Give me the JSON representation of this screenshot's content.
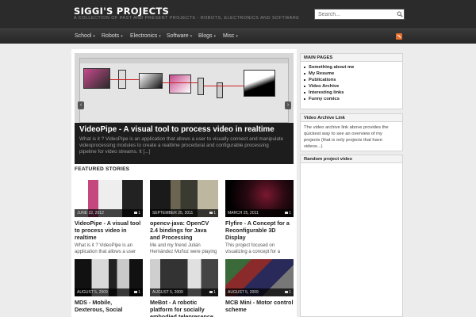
{
  "header": {
    "title": "SIGGI'S PROJECTS",
    "description": "A COLLECTION OF PAST AND PRESENT PROJECTS - ROBOTS, ELECTRONICS AND SOFTWARE",
    "search_placeholder": "Search..."
  },
  "nav": {
    "items": [
      {
        "label": "School"
      },
      {
        "label": "Robots"
      },
      {
        "label": "Electronics"
      },
      {
        "label": "Software"
      },
      {
        "label": "Blogs"
      },
      {
        "label": "Misc"
      }
    ],
    "caret": "▾"
  },
  "slider": {
    "title": "VideoPipe - A visual tool to process video in realtime",
    "excerpt": "What is it ? VideoPipe is an application that allows a user to visually connect and manipulate videoprocessing modules to create a realtime procedural and configurable processing pipeline for video streams. It [...]",
    "prev": "‹",
    "next": "›"
  },
  "featured": {
    "heading": "FEATURED STORIES",
    "stories": [
      {
        "date": "JUNE 22, 2012",
        "comments": "1",
        "title": "VideoPipe - A visual tool to process video in realtime",
        "excerpt": "What is it ? VideoPipe is an application that allows a user"
      },
      {
        "date": "SEPTEMBER 25, 2011",
        "comments": "1",
        "title": "opencv-java: OpenCV 2.4 bindings for Java and Processing",
        "excerpt": "Me and my friend Julián Hernández Muñoz were playing"
      },
      {
        "date": "MARCH 25, 2011",
        "comments": "1",
        "title": "Flyfire - A Concept for a Reconfigurable 3D Display",
        "excerpt": "This project focused on visualizing a concept for a"
      },
      {
        "date": "AUGUST 5, 2009",
        "comments": "1",
        "title": "MDS - Mobile, Dexterous, Social",
        "excerpt": ""
      },
      {
        "date": "AUGUST 5, 2009",
        "comments": "1",
        "title": "MeBot - A robotic platform for socially embodied telepresence",
        "excerpt": ""
      },
      {
        "date": "AUGUST 5, 2009",
        "comments": "1",
        "title": "MCB Mini - Motor control scheme",
        "excerpt": ""
      }
    ]
  },
  "sidebar": {
    "main_pages": {
      "title": "MAIN PAGES",
      "items": [
        "Something about me",
        "My Resume",
        "Publications",
        "Video Archive",
        "Interesting links",
        "Funny comics"
      ]
    },
    "video_archive": {
      "title": "Video Archive Link",
      "text": "The video archive link above provides the quickest way to see an overview of my projects (that is only projects that have videos...)"
    },
    "random_video": {
      "title": "Random project video"
    }
  },
  "colors": {
    "header_bg": "#2b2b2b",
    "page_bg": "#ececec",
    "rss": "#e3702d"
  }
}
